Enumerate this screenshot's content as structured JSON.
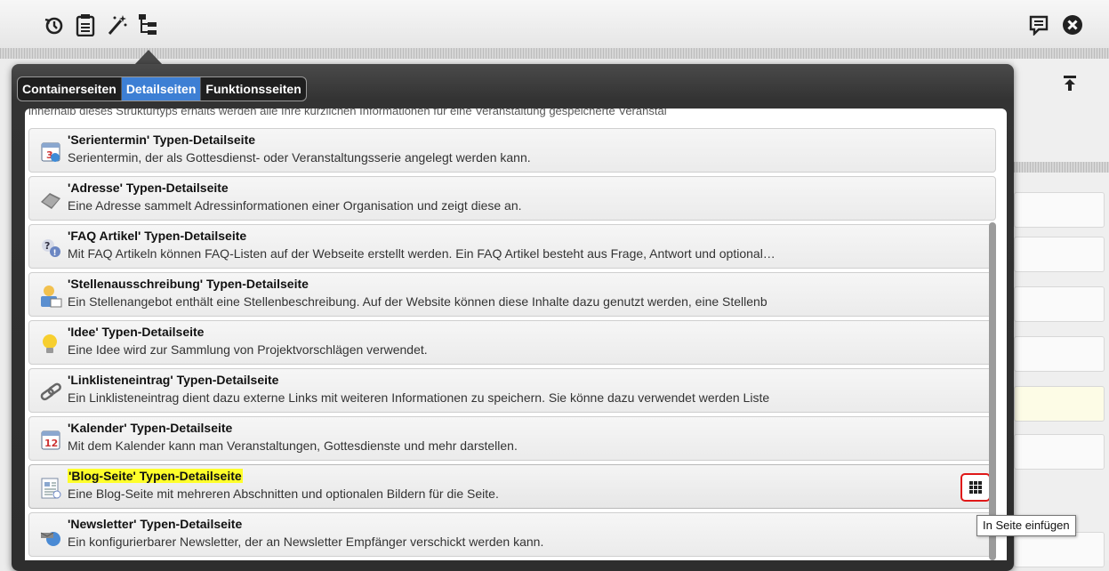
{
  "toolbar": {
    "icons": [
      "history-icon",
      "clipboard-icon",
      "magic-wand-icon",
      "tree-structure-icon"
    ],
    "right_icons": [
      "comment-icon",
      "close-icon"
    ]
  },
  "tabs": [
    {
      "label": "Containerseiten",
      "active": false
    },
    {
      "label": "Detailseiten",
      "active": true
    },
    {
      "label": "Funktionsseiten",
      "active": false
    }
  ],
  "cut_off_text": "innerhalb dieses Strukturtyps erhalts werden alle Ihre kürzlichen Informationen für eine Veranstaltung gespeicherte Veranstal",
  "items": [
    {
      "title": "'Serientermin' Typen-Detailseite",
      "desc": "Serientermin, der als Gottesdienst- oder Veranstaltungsserie angelegt werden kann.",
      "icon": "series-calendar-icon"
    },
    {
      "title": "'Adresse' Typen-Detailseite",
      "desc": "Eine Adresse sammelt Adressinformationen einer Organisation und zeigt diese an.",
      "icon": "address-book-icon"
    },
    {
      "title": "'FAQ Artikel' Typen-Detailseite",
      "desc": "Mit FAQ Artikeln können FAQ-Listen auf der Webseite erstellt werden. Ein FAQ Artikel besteht aus Frage, Antwort und optional…",
      "icon": "faq-icon"
    },
    {
      "title": "'Stellenausschreibung' Typen-Detailseite",
      "desc": "Ein Stellenangebot enthält eine Stellenbeschreibung. Auf der Website können diese Inhalte dazu genutzt werden, eine Stellenb",
      "icon": "job-icon"
    },
    {
      "title": "'Idee' Typen-Detailseite",
      "desc": "Eine Idee wird zur Sammlung von Projektvorschlägen verwendet.",
      "icon": "lightbulb-icon"
    },
    {
      "title": "'Linklisteneintrag' Typen-Detailseite",
      "desc": "Ein Linklisteneintrag dient dazu externe Links mit weiteren Informationen zu speichern. Sie könne dazu verwendet werden Liste",
      "icon": "link-icon"
    },
    {
      "title": "'Kalender' Typen-Detailseite",
      "desc": "Mit dem Kalender kann man Veranstaltungen, Gottesdienste und mehr darstellen.",
      "icon": "calendar-icon"
    },
    {
      "title": "'Blog-Seite' Typen-Detailseite",
      "desc": "Eine Blog-Seite mit mehreren Abschnitten und optionalen Bildern für die Seite.",
      "icon": "blog-page-icon",
      "highlighted": true
    },
    {
      "title": "'Newsletter' Typen-Detailseite",
      "desc": "Ein konfigurierbarer Newsletter, der an Newsletter Empfänger verschickt werden kann.",
      "icon": "newsletter-icon"
    }
  ],
  "tooltip": "In Seite einfügen",
  "colors": {
    "tab_active": "#3d7fd4",
    "highlight": "#ffff2a",
    "insert_border": "#e01818"
  }
}
